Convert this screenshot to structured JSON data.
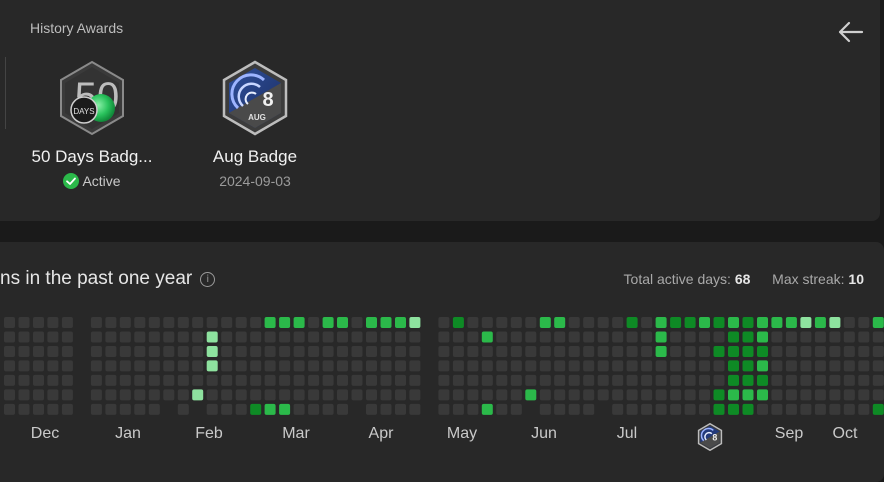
{
  "awards": {
    "title": "History Awards",
    "badges": [
      {
        "name": "50 Days Badg...",
        "status": "Active",
        "badge_number": "50",
        "badge_word": "DAYS"
      },
      {
        "name": "Aug Badge",
        "date": "2024-09-03",
        "badge_number": "8",
        "badge_word": "AUG"
      }
    ]
  },
  "calendar": {
    "title": "ns in the past one year",
    "stats": {
      "active_days_label": "Total active days:",
      "active_days": "68",
      "max_streak_label": "Max streak:",
      "max_streak": "10"
    },
    "months": [
      "Dec",
      "Jan",
      "Feb",
      "Mar",
      "Apr",
      "May",
      "Jun",
      "Jul",
      "Aug",
      "Sep",
      "Oct"
    ],
    "colors": {
      "empty": "#393939",
      "level1": "#0e8a25",
      "level2": "#2bb94a",
      "level3": "#8ee29f"
    },
    "grid": [
      "0000000",
      "0000000",
      "0000000",
      "0000000",
      "0000000",
      "",
      "0000000",
      "0000000",
      "0000000",
      "0000000",
      "0000000",
      "000000",
      "0000000",
      "000003",
      "0333000",
      "0000000",
      "0000000",
      "0000001",
      "2000002",
      "2000002",
      "2000000",
      "0000000",
      "2000000",
      "2000000",
      "000000",
      "2000000",
      "2000000",
      "2000000",
      "3000000",
      "",
      "0000000",
      "1000000",
      "0000000",
      "0200002",
      "0000000",
      "0000000",
      "000002",
      "2000000",
      "2000000",
      "0000000",
      "0000000",
      "000000",
      "0000000",
      "1000000",
      "0000000",
      "2220000",
      "1000000",
      "1000000",
      "2000000",
      "1010011",
      "2111121",
      "1111121",
      "2212120",
      "2000000",
      "2000000",
      "3000000",
      "2000000",
      "3000000",
      "0000000",
      "0000000",
      "2000001"
    ]
  }
}
